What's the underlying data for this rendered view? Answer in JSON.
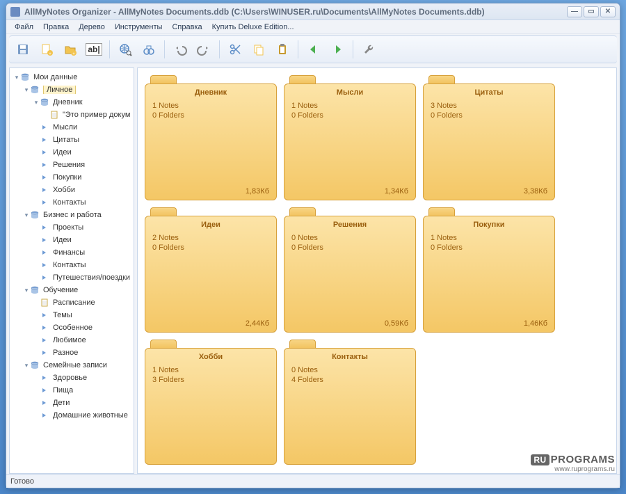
{
  "title": "AllMyNotes Organizer - AllMyNotes Documents.ddb (C:\\Users\\WINUSER.ru\\Documents\\AllMyNotes Documents.ddb)",
  "menu": [
    "Файл",
    "Правка",
    "Дерево",
    "Инструменты",
    "Справка",
    "Купить Deluxe Edition..."
  ],
  "toolbar_icons": [
    {
      "name": "save-icon",
      "color": "#7a9cc7",
      "type": "floppy"
    },
    {
      "name": "new-note-icon",
      "color": "#f2c451",
      "type": "note-plus"
    },
    {
      "name": "new-folder-icon",
      "color": "#f2c451",
      "type": "folder-plus"
    },
    {
      "name": "rename-icon",
      "color": "#333",
      "type": "text",
      "text": "ab|"
    },
    {
      "name": "sep"
    },
    {
      "name": "global-search-icon",
      "color": "#5a8bc6",
      "type": "globe-search"
    },
    {
      "name": "find-icon",
      "color": "#5a8bc6",
      "type": "binoc"
    },
    {
      "name": "sep"
    },
    {
      "name": "undo-icon",
      "color": "#888",
      "type": "undo"
    },
    {
      "name": "redo-icon",
      "color": "#888",
      "type": "redo"
    },
    {
      "name": "sep"
    },
    {
      "name": "cut-icon",
      "color": "#5a8bc6",
      "type": "scissors"
    },
    {
      "name": "copy-icon",
      "color": "#f2c451",
      "type": "copy"
    },
    {
      "name": "paste-icon",
      "color": "#f2c451",
      "type": "paste"
    },
    {
      "name": "sep"
    },
    {
      "name": "back-icon",
      "color": "#4caf50",
      "type": "arrow-left"
    },
    {
      "name": "forward-icon",
      "color": "#4caf50",
      "type": "arrow-right"
    },
    {
      "name": "sep"
    },
    {
      "name": "settings-icon",
      "color": "#888",
      "type": "wrench"
    }
  ],
  "tree": [
    {
      "depth": 0,
      "icon": "db",
      "label": "Мои данные",
      "exp": "-"
    },
    {
      "depth": 1,
      "icon": "db",
      "label": "Личное",
      "exp": "-",
      "selected": true
    },
    {
      "depth": 2,
      "icon": "db",
      "label": "Дневник",
      "exp": "-"
    },
    {
      "depth": 3,
      "icon": "doc",
      "label": "\"Это пример докум",
      "exp": ""
    },
    {
      "depth": 2,
      "icon": "arrow",
      "label": "Мысли",
      "exp": ""
    },
    {
      "depth": 2,
      "icon": "arrow",
      "label": "Цитаты",
      "exp": ""
    },
    {
      "depth": 2,
      "icon": "arrow",
      "label": "Идеи",
      "exp": ""
    },
    {
      "depth": 2,
      "icon": "arrow",
      "label": "Решения",
      "exp": ""
    },
    {
      "depth": 2,
      "icon": "arrow",
      "label": "Покупки",
      "exp": ""
    },
    {
      "depth": 2,
      "icon": "arrow",
      "label": "Хобби",
      "exp": ""
    },
    {
      "depth": 2,
      "icon": "arrow",
      "label": "Контакты",
      "exp": ""
    },
    {
      "depth": 1,
      "icon": "db",
      "label": "Бизнес и работа",
      "exp": "-"
    },
    {
      "depth": 2,
      "icon": "arrow",
      "label": "Проекты",
      "exp": ""
    },
    {
      "depth": 2,
      "icon": "arrow",
      "label": "Идеи",
      "exp": ""
    },
    {
      "depth": 2,
      "icon": "arrow",
      "label": "Финансы",
      "exp": ""
    },
    {
      "depth": 2,
      "icon": "arrow",
      "label": "Контакты",
      "exp": ""
    },
    {
      "depth": 2,
      "icon": "arrow",
      "label": "Путешествия/поездки",
      "exp": ""
    },
    {
      "depth": 1,
      "icon": "db",
      "label": "Обучение",
      "exp": "-"
    },
    {
      "depth": 2,
      "icon": "doc",
      "label": "Расписание",
      "exp": ""
    },
    {
      "depth": 2,
      "icon": "arrow",
      "label": "Темы",
      "exp": ""
    },
    {
      "depth": 2,
      "icon": "arrow",
      "label": "Особенное",
      "exp": ""
    },
    {
      "depth": 2,
      "icon": "arrow",
      "label": "Любимое",
      "exp": ""
    },
    {
      "depth": 2,
      "icon": "arrow",
      "label": "Разное",
      "exp": ""
    },
    {
      "depth": 1,
      "icon": "db",
      "label": "Семейные записи",
      "exp": "-"
    },
    {
      "depth": 2,
      "icon": "arrow",
      "label": "Здоровье",
      "exp": ""
    },
    {
      "depth": 2,
      "icon": "arrow",
      "label": "Пища",
      "exp": ""
    },
    {
      "depth": 2,
      "icon": "arrow",
      "label": "Дети",
      "exp": ""
    },
    {
      "depth": 2,
      "icon": "arrow",
      "label": "Домашние животные",
      "exp": ""
    }
  ],
  "folders": [
    {
      "title": "Дневник",
      "notes": "1 Notes",
      "subs": "0 Folders",
      "size": "1,83Кб"
    },
    {
      "title": "Мысли",
      "notes": "1 Notes",
      "subs": "0 Folders",
      "size": "1,34Кб"
    },
    {
      "title": "Цитаты",
      "notes": "3 Notes",
      "subs": "0 Folders",
      "size": "3,38Кб"
    },
    {
      "title": "Идеи",
      "notes": "2 Notes",
      "subs": "0 Folders",
      "size": "2,44Кб"
    },
    {
      "title": "Решения",
      "notes": "0 Notes",
      "subs": "0 Folders",
      "size": "0,59Кб"
    },
    {
      "title": "Покупки",
      "notes": "1 Notes",
      "subs": "0 Folders",
      "size": "1,46Кб"
    },
    {
      "title": "Хобби",
      "notes": "1 Notes",
      "subs": "3 Folders",
      "size": ""
    },
    {
      "title": "Контакты",
      "notes": "0 Notes",
      "subs": "4 Folders",
      "size": ""
    }
  ],
  "status": "Готово",
  "watermark": {
    "tag": "RU",
    "brand": "PROGRAMS",
    "url": "www.ruprograms.ru"
  }
}
